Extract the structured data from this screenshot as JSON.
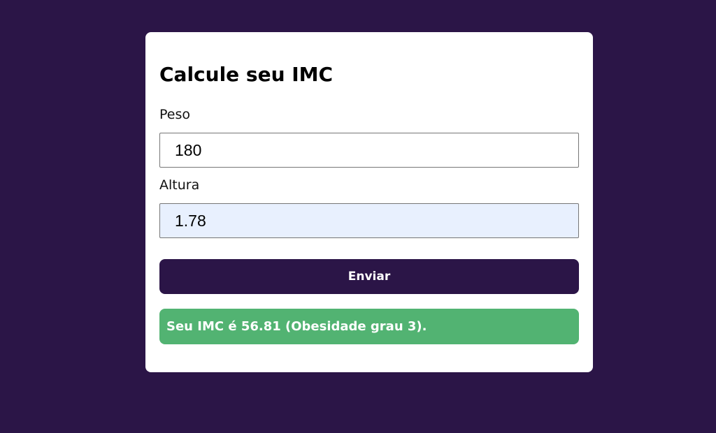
{
  "form": {
    "title": "Calcule seu IMC",
    "peso_label": "Peso",
    "peso_value": "180",
    "altura_label": "Altura",
    "altura_value": "1.78",
    "submit_label": "Enviar"
  },
  "result": {
    "text": "Seu IMC é 56.81 (Obesidade grau 3)."
  },
  "colors": {
    "background": "#2b1547",
    "card": "#ffffff",
    "button": "#2b1547",
    "result": "#52b372",
    "autofill": "#e8f0fe"
  }
}
